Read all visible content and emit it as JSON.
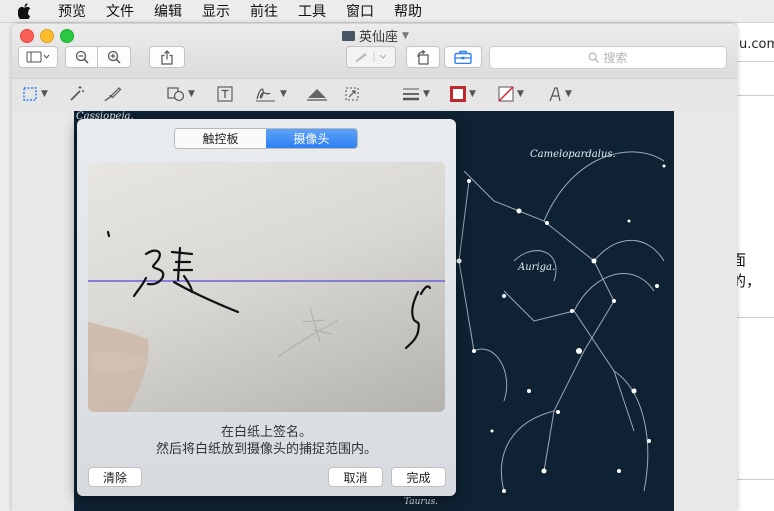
{
  "menubar": {
    "items": [
      "预览",
      "文件",
      "编辑",
      "显示",
      "前往",
      "工具",
      "窗口",
      "帮助"
    ]
  },
  "window": {
    "title": "英仙座"
  },
  "toolbar": {
    "search_placeholder": "搜索"
  },
  "background": {
    "url_fragment": "u.com",
    "text_fragment": "面的，"
  },
  "starmap": {
    "labels": [
      "Cassiopeja.",
      "Camelopardalus.",
      "Auriga.",
      "Taurus."
    ]
  },
  "signature_panel": {
    "tabs": [
      {
        "label": "触控板",
        "selected": false
      },
      {
        "label": "摄像头",
        "selected": true
      }
    ],
    "instructions": [
      "在白纸上签名。",
      "然后将白纸放到摄像头的捕捉范围内。"
    ],
    "clear_label": "清除",
    "cancel_label": "取消",
    "done_label": "完成"
  },
  "colors": {
    "accent": "#2d7ff4",
    "capture_line": "#6a5fd8",
    "border_color_swatch": "#c0282d"
  }
}
